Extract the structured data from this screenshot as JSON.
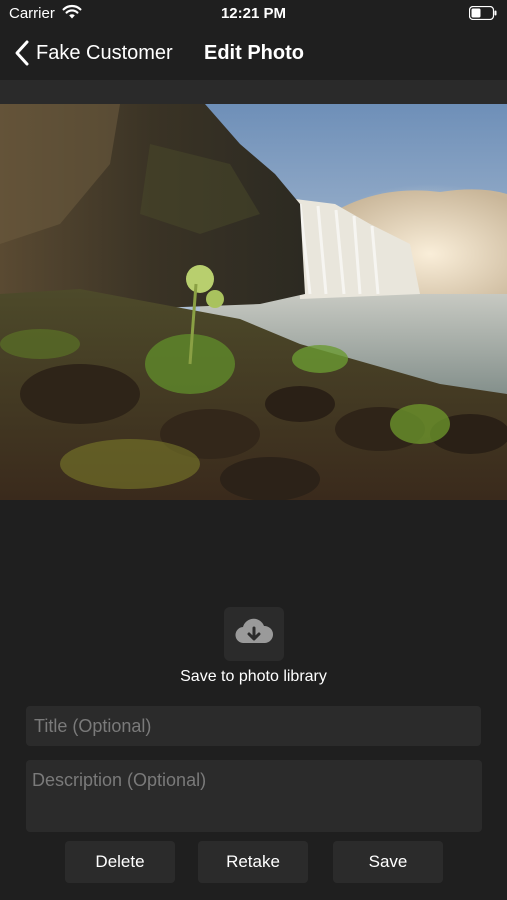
{
  "status_bar": {
    "carrier": "Carrier",
    "time": "12:21 PM",
    "wifi_icon": "wifi-icon",
    "battery_icon": "battery-icon"
  },
  "nav": {
    "back_label": "Fake Customer",
    "back_icon": "chevron-left-icon",
    "title": "Edit Photo"
  },
  "photo": {
    "subject": "waterfall-landscape"
  },
  "save_library": {
    "icon": "cloud-download-icon",
    "label": "Save to photo library"
  },
  "form": {
    "title_placeholder": "Title (Optional)",
    "title_value": "",
    "description_placeholder": "Description (Optional)",
    "description_value": ""
  },
  "actions": {
    "delete_label": "Delete",
    "retake_label": "Retake",
    "save_label": "Save"
  },
  "colors": {
    "background": "#1f1f1f",
    "control_bg": "#2b2b2b",
    "placeholder": "#7a7a7a",
    "text": "#ffffff"
  }
}
